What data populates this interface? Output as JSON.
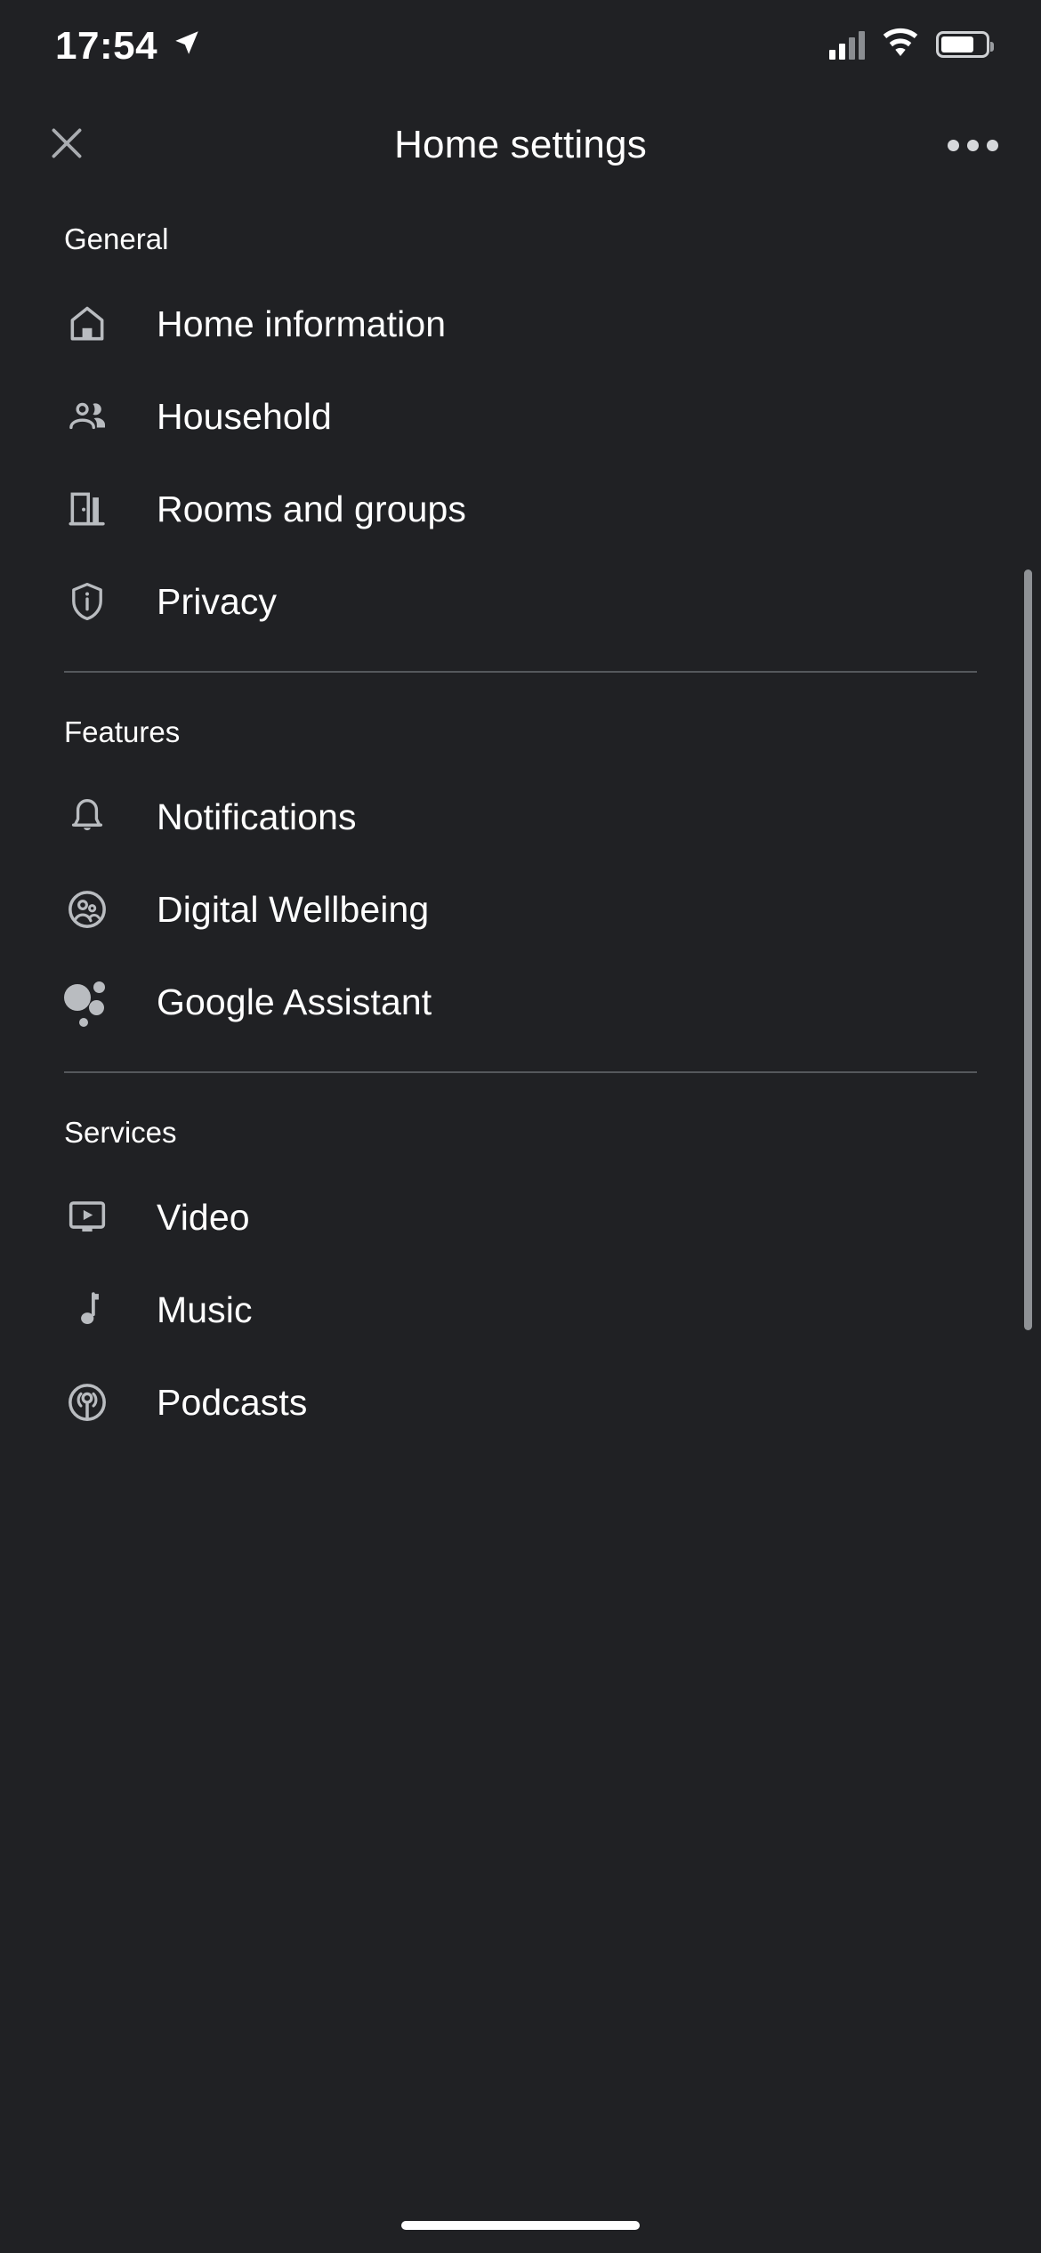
{
  "status_bar": {
    "time": "17:54",
    "location_icon": "location-arrow-icon",
    "signal_icon": "cellular-signal-icon",
    "signal_bars_filled": 2,
    "signal_bars_total": 4,
    "wifi_icon": "wifi-icon",
    "battery_icon": "battery-icon",
    "battery_level_percent": 74
  },
  "app_bar": {
    "close_label": "close-icon",
    "title": "Home settings",
    "more_label": "more-options-icon"
  },
  "sections": [
    {
      "title": "General",
      "items": [
        {
          "label": "Home information",
          "icon": "house-icon"
        },
        {
          "label": "Household",
          "icon": "people-icon"
        },
        {
          "label": "Rooms and groups",
          "icon": "door-icon"
        },
        {
          "label": "Privacy",
          "icon": "shield-info-icon"
        }
      ]
    },
    {
      "title": "Features",
      "items": [
        {
          "label": "Notifications",
          "icon": "bell-icon"
        },
        {
          "label": "Digital Wellbeing",
          "icon": "family-circle-icon"
        },
        {
          "label": "Google Assistant",
          "icon": "google-assistant-icon"
        }
      ]
    },
    {
      "title": "Services",
      "items": [
        {
          "label": "Video",
          "icon": "video-monitor-play-icon"
        },
        {
          "label": "Music",
          "icon": "music-note-icon"
        },
        {
          "label": "Podcasts",
          "icon": "podcast-broadcast-icon"
        }
      ]
    }
  ],
  "colors": {
    "background": "#202124",
    "primary_text": "#ffffff",
    "icon": "#b9bcc0",
    "divider": "#55585c",
    "scrollbar": "#8f9296"
  }
}
